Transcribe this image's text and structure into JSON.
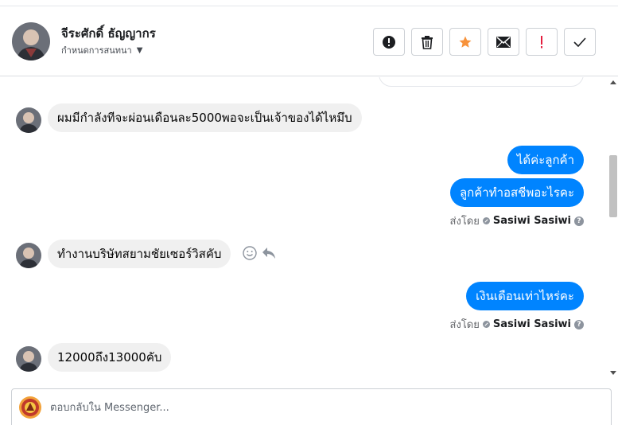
{
  "header": {
    "name": "จีระศักดิ์ ธัญญากร",
    "assign_label": "กำหนดการสนทนา",
    "actions": [
      {
        "id": "spam",
        "icon": "alert-circle-icon"
      },
      {
        "id": "delete",
        "icon": "trash-icon"
      },
      {
        "id": "star",
        "icon": "star-icon"
      },
      {
        "id": "unread",
        "icon": "envelope-icon"
      },
      {
        "id": "follow-up",
        "icon": "exclamation-icon"
      },
      {
        "id": "done",
        "icon": "check-icon"
      }
    ]
  },
  "colors": {
    "outgoing_bubble": "#0084ff",
    "incoming_bubble": "#f0f0f0",
    "star": "#f7923b",
    "follow_up": "#e41e3f"
  },
  "thread": {
    "messages": [
      {
        "direction": "in",
        "text": "ผมมีกำลังทีจะผ่อนเดือนละ5000พอจะเป็นเจ้าของได้ไหมึบ"
      },
      {
        "direction": "out",
        "text": "ได้ค่ะลูกค้า"
      },
      {
        "direction": "out",
        "text": "ลูกค้าทำอสชีพอะไรคะ"
      },
      {
        "direction": "in",
        "text": "ทำงานบริษัทสยามชัยเซอร์วิสคับ"
      },
      {
        "direction": "out",
        "text": "เงินเดือนเท่าไหร่คะ"
      },
      {
        "direction": "in",
        "text": "12000ถึง13000คับ"
      }
    ],
    "sent_by_label": "ส่งโดย",
    "sent_by_name": "Sasiwi Sasiwi"
  },
  "composer": {
    "placeholder": "ตอบกลับใน Messenger..."
  }
}
